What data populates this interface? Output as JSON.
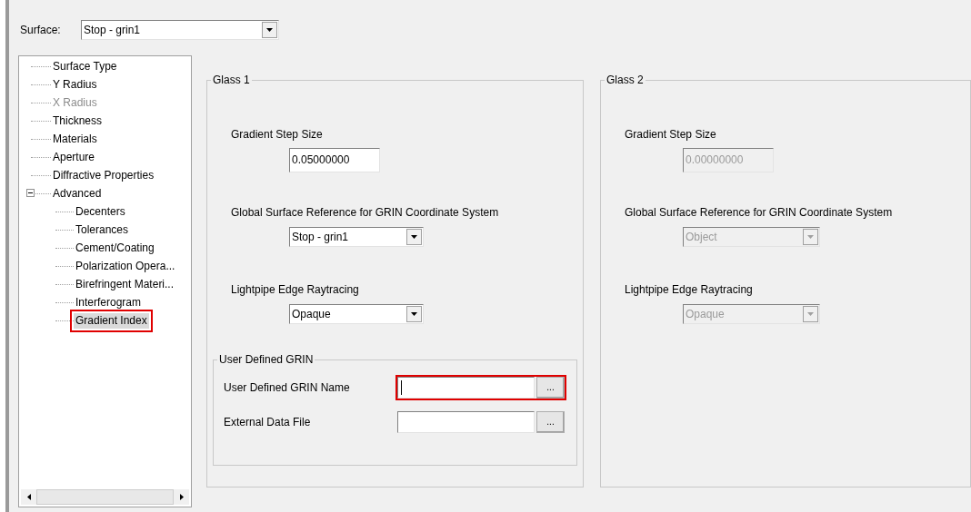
{
  "surface": {
    "label": "Surface:",
    "value": "Stop - grin1"
  },
  "tree": {
    "items": [
      {
        "label": "Surface Type",
        "disabled": false,
        "selected": false,
        "highlighted": false
      },
      {
        "label": "Y Radius",
        "disabled": false,
        "selected": false,
        "highlighted": false
      },
      {
        "label": "X Radius",
        "disabled": true,
        "selected": false,
        "highlighted": false
      },
      {
        "label": "Thickness",
        "disabled": false,
        "selected": false,
        "highlighted": false
      },
      {
        "label": "Materials",
        "disabled": false,
        "selected": false,
        "highlighted": false
      },
      {
        "label": "Aperture",
        "disabled": false,
        "selected": false,
        "highlighted": false
      },
      {
        "label": "Diffractive Properties",
        "disabled": false,
        "selected": false,
        "highlighted": false
      },
      {
        "label": "Advanced",
        "disabled": false,
        "selected": false,
        "highlighted": false,
        "expanded": true,
        "children": [
          {
            "label": "Decenters",
            "disabled": false,
            "selected": false,
            "highlighted": false
          },
          {
            "label": "Tolerances",
            "disabled": false,
            "selected": false,
            "highlighted": false
          },
          {
            "label": "Cement/Coating",
            "disabled": false,
            "selected": false,
            "highlighted": false
          },
          {
            "label": "Polarization Opera...",
            "disabled": false,
            "selected": false,
            "highlighted": false
          },
          {
            "label": "Birefringent Materi...",
            "disabled": false,
            "selected": false,
            "highlighted": false
          },
          {
            "label": "Interferogram",
            "disabled": false,
            "selected": false,
            "highlighted": false
          },
          {
            "label": "Gradient Index",
            "disabled": false,
            "selected": true,
            "highlighted": true
          }
        ]
      }
    ]
  },
  "groups": [
    {
      "title": "Glass 1",
      "disabled": false,
      "step": {
        "label": "Gradient Step Size",
        "value": "0.05000000"
      },
      "reference": {
        "label": "Global Surface Reference for GRIN Coordinate System",
        "value": "Stop - grin1"
      },
      "lightpipe": {
        "label": "Lightpipe Edge Raytracing",
        "value": "Opaque"
      },
      "user_grin": {
        "title": "User Defined GRIN",
        "fields": [
          {
            "label": "User Defined GRIN Name",
            "button": "...",
            "focused": true,
            "highlighted": true
          },
          {
            "label": "External Data File",
            "button": "...",
            "focused": false,
            "highlighted": false
          }
        ]
      }
    },
    {
      "title": "Glass 2",
      "disabled": true,
      "step": {
        "label": "Gradient Step Size",
        "value": "0.00000000"
      },
      "reference": {
        "label": "Global Surface Reference for GRIN Coordinate System",
        "value": "Object"
      },
      "lightpipe": {
        "label": "Lightpipe Edge Raytracing",
        "value": "Opaque"
      }
    }
  ]
}
